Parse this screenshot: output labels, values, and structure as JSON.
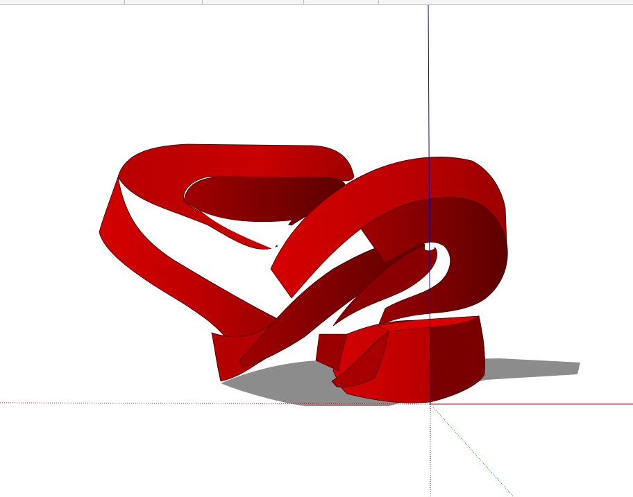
{
  "app": {
    "title": ""
  },
  "toolbar": {
    "tabs": [
      {
        "label": ""
      },
      {
        "label": ""
      },
      {
        "label": ""
      },
      {
        "label": ""
      }
    ]
  },
  "viewport": {
    "background": "#ffffff"
  },
  "model": {
    "name": "red-ribbon-sculpture",
    "color": "#c40000",
    "dark_color": "#6e0000",
    "shadow_color": "#8a8a8a"
  },
  "axes": {
    "red": "#c00000",
    "green": "#1a8a1a",
    "blue": "#0a0aa0"
  }
}
